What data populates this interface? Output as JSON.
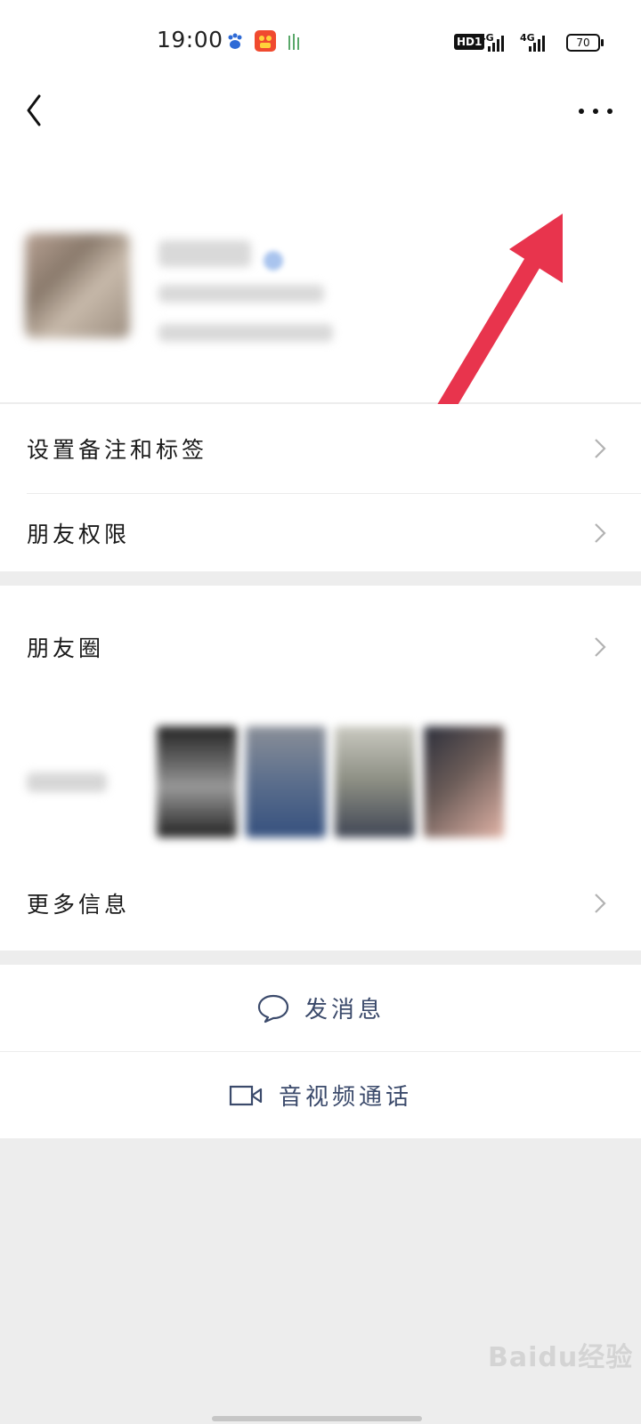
{
  "status_bar": {
    "time": "19:00",
    "hd": "HD1",
    "network_1": "4G",
    "network_2": "4G",
    "battery": "70",
    "icons": [
      "baidu-paw-icon",
      "kuaishou-icon",
      "bamboo-app-icon"
    ]
  },
  "nav": {
    "back_icon": "chevron-left-icon",
    "more_icon": "more-dots-icon"
  },
  "menu_group_1": [
    {
      "label": "设置备注和标签"
    },
    {
      "label": "朋友权限"
    }
  ],
  "menu_group_2": [
    {
      "label": "朋友圈"
    },
    {
      "label": "更多信息"
    }
  ],
  "actions": {
    "message": "发消息",
    "call": "音视频通话"
  },
  "watermark": "Baidu经验",
  "colors": {
    "accent_text": "#3b4a6b",
    "arrow": "#e8344d",
    "background": "#ededed"
  }
}
